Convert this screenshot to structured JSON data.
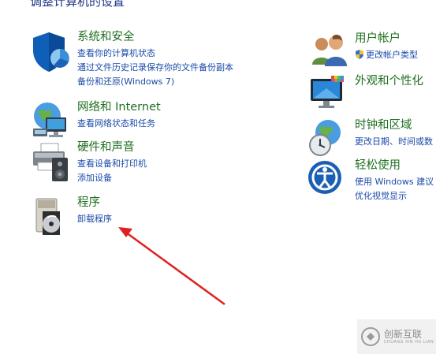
{
  "page_title": "调整计算机的设置",
  "categories": {
    "system_security": {
      "title": "系统和安全",
      "links": [
        "查看你的计算机状态",
        "通过文件历史记录保存你的文件备份副本",
        "备份和还原(Windows 7)"
      ]
    },
    "network": {
      "title": "网络和 Internet",
      "links": [
        "查看网络状态和任务"
      ]
    },
    "hardware_sound": {
      "title": "硬件和声音",
      "links": [
        "查看设备和打印机",
        "添加设备"
      ]
    },
    "programs": {
      "title": "程序",
      "links": [
        "卸载程序"
      ]
    },
    "user_accounts": {
      "title": "用户帐户",
      "links": [
        "更改帐户类型"
      ]
    },
    "appearance": {
      "title": "外观和个性化",
      "links": []
    },
    "clock_region": {
      "title": "时钟和区域",
      "links": [
        "更改日期、时间或数"
      ]
    },
    "ease_of_access": {
      "title": "轻松使用",
      "links": [
        "使用 Windows 建议",
        "优化视觉显示"
      ]
    }
  },
  "watermark": {
    "text": "创新互联",
    "subtext": "CHUANG XIN HU LIAN"
  },
  "colors": {
    "category_title": "#1f6f1f",
    "link": "#1a4aa8",
    "annotation_arrow": "#e02020"
  }
}
